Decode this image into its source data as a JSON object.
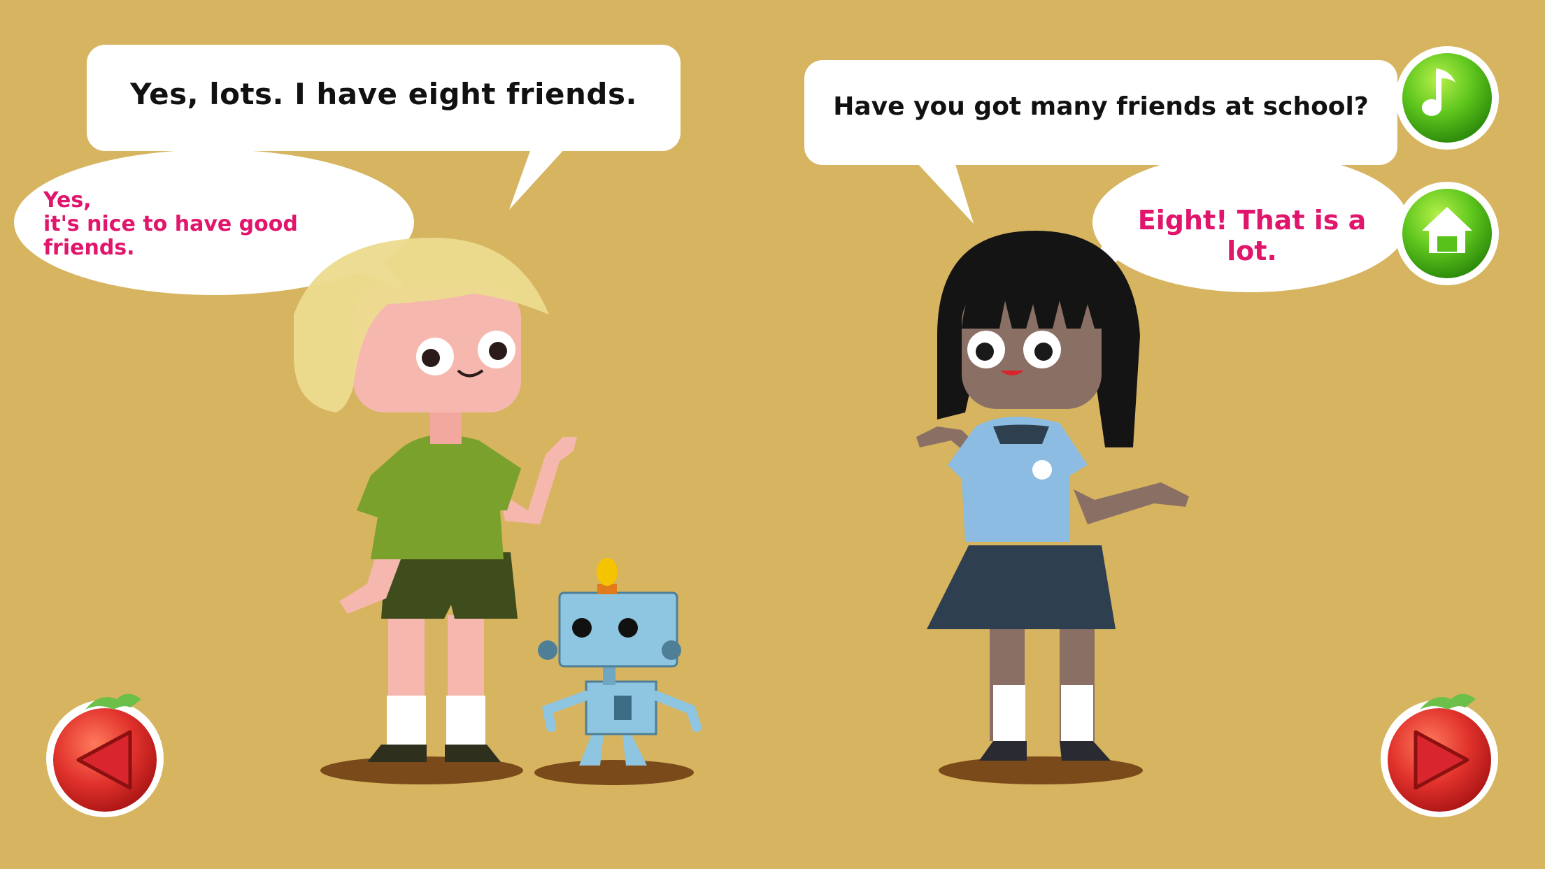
{
  "background_color": "#d6b460",
  "dialogue": {
    "boy_reply": "Yes, lots. I have eight friends.",
    "boy_second": "Yes,\nit's nice to have good friends.",
    "girl_question": "Have you got many friends at school?",
    "girl_second": "Eight! That is a lot."
  },
  "colors": {
    "primary_text": "#111111",
    "highlight_text": "#e0156b",
    "button_green": "#4cbb17",
    "button_red": "#d9262e"
  },
  "controls": {
    "audio_icon": "music-note-icon",
    "home_icon": "home-icon",
    "prev_icon": "triangle-left-icon",
    "next_icon": "triangle-right-icon"
  }
}
